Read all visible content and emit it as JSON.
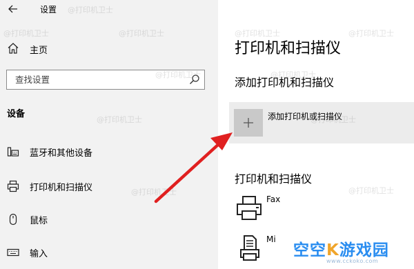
{
  "window": {
    "title": "设置"
  },
  "sidebar": {
    "home_label": "主页",
    "search": {
      "placeholder": "查找设置",
      "value": ""
    },
    "section_heading": "设备",
    "items": [
      {
        "label": "蓝牙和其他设备",
        "icon": "bluetooth-devices-icon"
      },
      {
        "label": "打印机和扫描仪",
        "icon": "printer-icon",
        "selected": true
      },
      {
        "label": "鼠标",
        "icon": "mouse-icon"
      },
      {
        "label": "输入",
        "icon": "keyboard-icon"
      }
    ]
  },
  "main": {
    "title": "打印机和扫描仪",
    "add_section_heading": "添加打印机和扫描仪",
    "add_button_label": "添加打印机或扫描仪",
    "list_heading": "打印机和扫描仪",
    "devices": [
      {
        "name": "Fax",
        "icon": "fax-icon"
      },
      {
        "name": "Mi",
        "icon": "printer-document-icon"
      }
    ]
  },
  "watermark": {
    "text": "@打印机卫士"
  },
  "logo": {
    "text_part1": "空空",
    "text_part2": "游戏园",
    "url": "www.cckoko.com"
  },
  "colors": {
    "sidebar_bg": "#f2f2f2",
    "add_row_bg": "#ececec",
    "add_tile_bg": "#c9c9c9",
    "arrow": "#e02020",
    "logo_blue": "#2a8df0",
    "logo_gold": "#f0a52b"
  }
}
